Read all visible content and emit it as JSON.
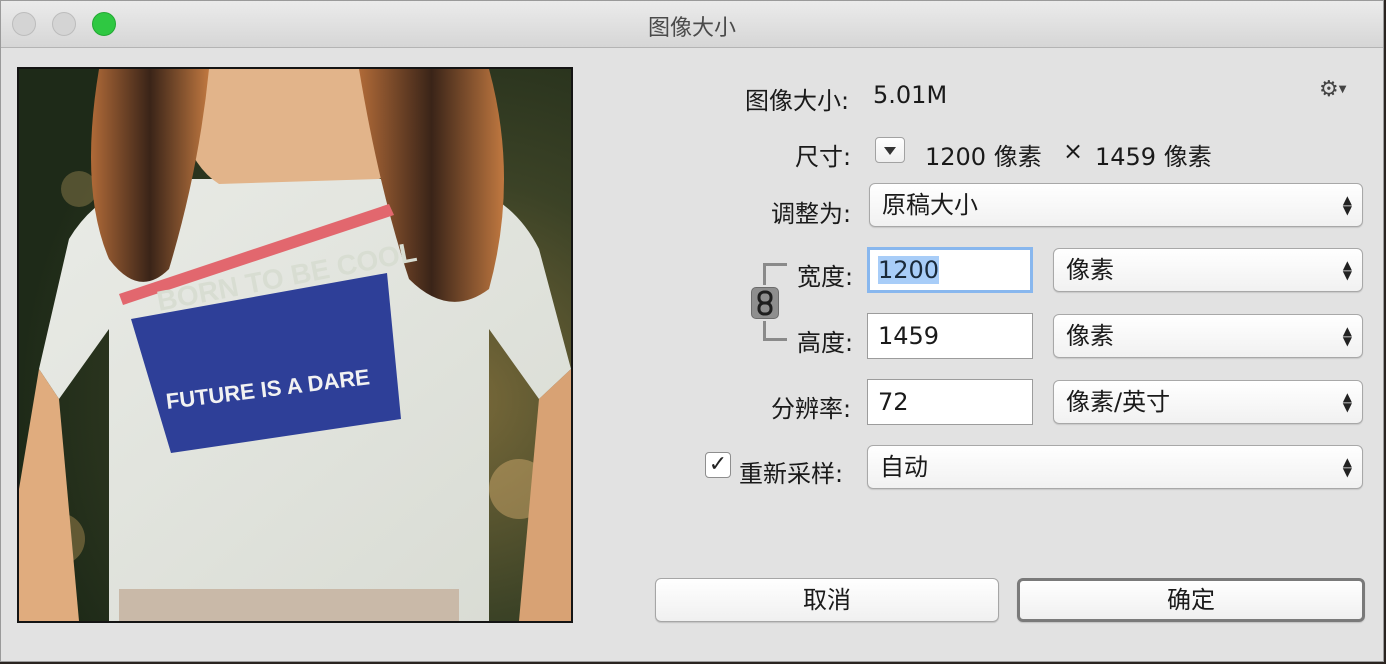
{
  "window": {
    "title": "图像大小"
  },
  "image_size": {
    "label": "图像大小:",
    "value": "5.01M"
  },
  "dimensions": {
    "label": "尺寸:",
    "width": "1200 像素",
    "separator": "×",
    "height": "1459 像素"
  },
  "fit_to": {
    "label": "调整为:",
    "value": "原稿大小"
  },
  "width": {
    "label": "宽度:",
    "value": "1200",
    "unit": "像素"
  },
  "height": {
    "label": "高度:",
    "value": "1459",
    "unit": "像素"
  },
  "resolution": {
    "label": "分辨率:",
    "value": "72",
    "unit": "像素/英寸"
  },
  "resample": {
    "label": "重新采样:",
    "checked": true,
    "check_mark": "✓",
    "method": "自动"
  },
  "buttons": {
    "cancel": "取消",
    "ok": "确定"
  },
  "preview": {
    "shirt_text_top": "BORN TO BE COOL",
    "shirt_text_bottom": "FUTURE IS A DARE"
  },
  "icons": {
    "gear": "gear-icon",
    "link": "link-icon",
    "disclosure": "disclosure-triangle-icon",
    "stepper": "up-down-arrows-icon"
  }
}
